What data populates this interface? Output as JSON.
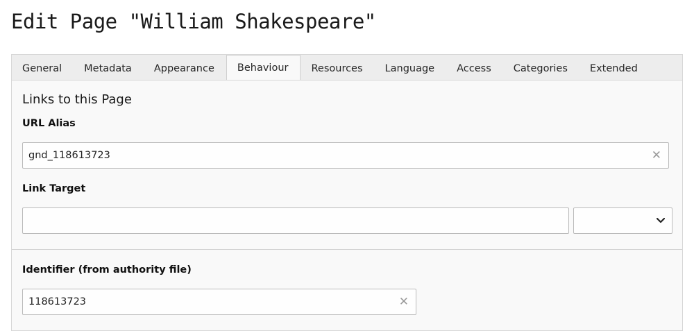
{
  "page": {
    "title": "Edit Page \"William Shakespeare\""
  },
  "tabs": [
    {
      "label": "General"
    },
    {
      "label": "Metadata"
    },
    {
      "label": "Appearance"
    },
    {
      "label": "Behaviour",
      "active": true
    },
    {
      "label": "Resources"
    },
    {
      "label": "Language"
    },
    {
      "label": "Access"
    },
    {
      "label": "Categories"
    },
    {
      "label": "Extended"
    }
  ],
  "links_section": {
    "title": "Links to this Page",
    "url_alias": {
      "label": "URL Alias",
      "value": "gnd_118613723",
      "clear_icon": "close-icon"
    },
    "link_target": {
      "label": "Link Target",
      "value": "",
      "select_value": "",
      "select_icon": "chevron-down-icon"
    }
  },
  "identifier_section": {
    "label": "Identifier (from authority file)",
    "value": "118613723",
    "clear_icon": "close-icon"
  },
  "colors": {
    "background": "#ffffff",
    "panel": "#f9f9f9",
    "tabbar": "#ededed",
    "border": "#d7d7d7"
  }
}
